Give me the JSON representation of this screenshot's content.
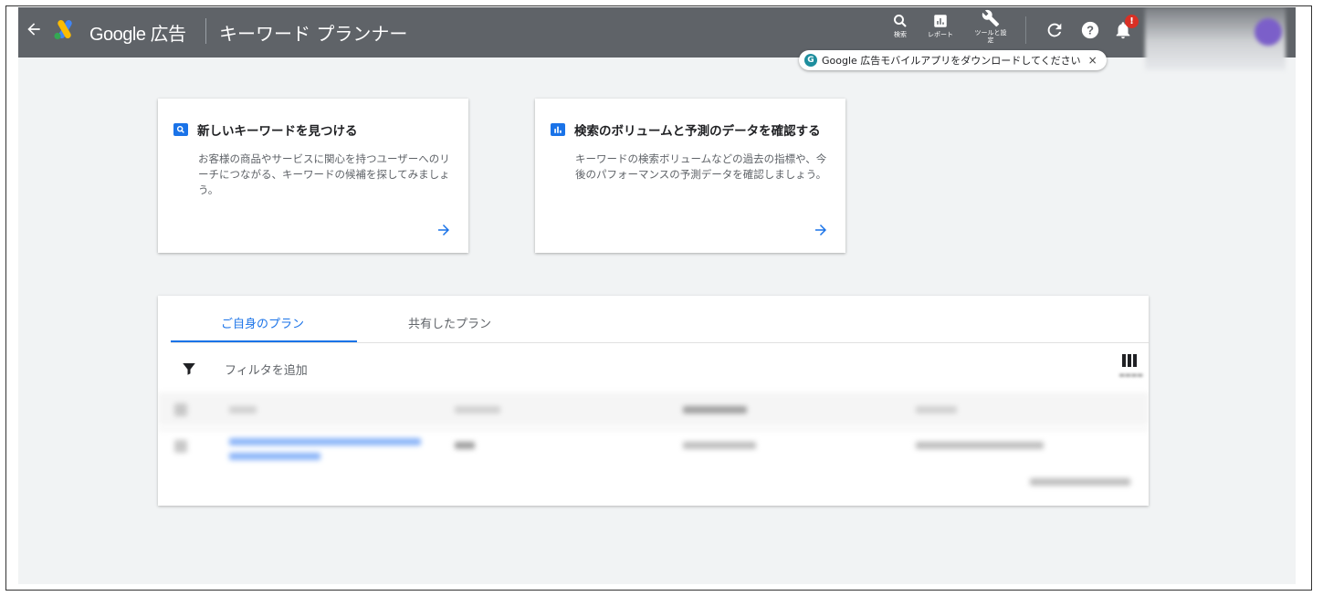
{
  "header": {
    "brand": "Google 広告",
    "page_title": "キーワード プランナー",
    "tools": [
      {
        "icon": "search-icon",
        "label": "検索"
      },
      {
        "icon": "report-icon",
        "label": "レポート"
      },
      {
        "icon": "wrench-icon",
        "label": "ツールと設定"
      }
    ],
    "notification_badge": "!",
    "promo": {
      "icon_glyph": "G",
      "text": "Google 広告モバイルアプリをダウンロードしてください",
      "close": "×"
    }
  },
  "cards": [
    {
      "icon": "search-icon",
      "title": "新しいキーワードを見つける",
      "description": "お客様の商品やサービスに関心を持つユーザーへのリーチにつながる、キーワードの候補を探してみましょう。"
    },
    {
      "icon": "bar-chart-icon",
      "title": "検索のボリュームと予測のデータを確認する",
      "description": "キーワードの検索ボリュームなどの過去の指標や、今後のパフォーマンスの予測データを確認しましょう。"
    }
  ],
  "plans": {
    "tabs": [
      {
        "label": "ご自身のプラン",
        "active": true
      },
      {
        "label": "共有したプラン",
        "active": false
      }
    ],
    "filter_label": "フィルタを追加"
  },
  "colors": {
    "header_bg": "#5f6368",
    "accent": "#1a73e8",
    "page_bg": "#f1f3f4",
    "badge": "#d93025"
  }
}
